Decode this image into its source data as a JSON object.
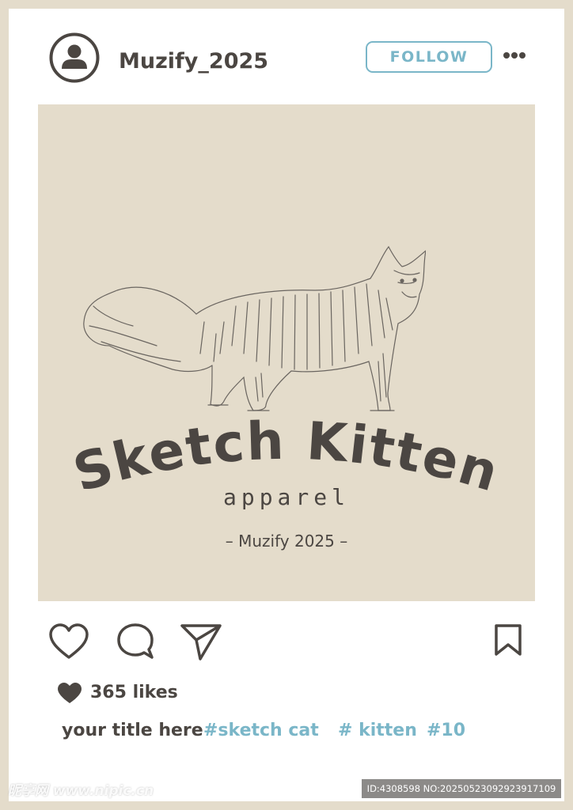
{
  "header": {
    "username": "Muzify_2025",
    "follow_label": "FOLLOW",
    "avatar_icon": "user-avatar-icon",
    "more_icon": "more-dots-icon"
  },
  "post": {
    "brand_title": "Sketch Kitten",
    "brand_subtitle": "apparel",
    "brand_credit": "– Muzify 2025 –",
    "background_color": "#e4dccb"
  },
  "actions": {
    "like_icon": "heart-outline-icon",
    "comment_icon": "comment-bubble-icon",
    "share_icon": "paper-plane-icon",
    "save_icon": "bookmark-icon"
  },
  "stats": {
    "likes_text": "365 likes"
  },
  "caption": {
    "title": "your title here",
    "hashtags": [
      "#sketch cat",
      "# kitten",
      "#10"
    ]
  },
  "overlay": {
    "watermark": "昵享网 www.nipic.cn",
    "image_id": "ID:4308598 NO:20250523092923917109"
  },
  "colors": {
    "text": "#4b4642",
    "accent": "#7ab6c8",
    "frame": "#e4dccb"
  }
}
